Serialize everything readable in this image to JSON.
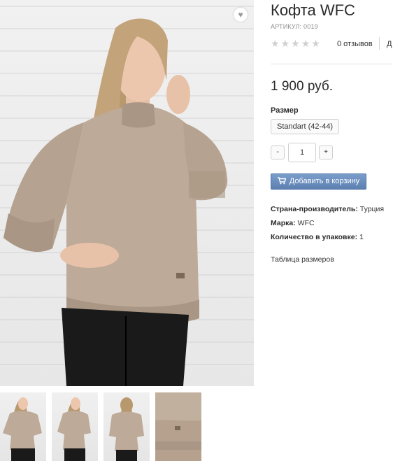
{
  "product": {
    "title": "Кофта WFC",
    "sku": "АРТИКУЛ: 0019",
    "rating_stars": 0,
    "reviews": "0 отзывов",
    "reviews_cut_link": "Д",
    "price": "1 900 руб."
  },
  "size": {
    "label": "Размер",
    "option": "Standart (42-44)"
  },
  "quantity": {
    "minus": "-",
    "value": "1",
    "plus": "+"
  },
  "cart_button": {
    "icon": "shopping-cart-icon",
    "label": "Добавить в корзину"
  },
  "properties": [
    {
      "name": "Страна-производитель:",
      "value": "Турция"
    },
    {
      "name": "Марка:",
      "value": "WFC"
    },
    {
      "name": "Количество в упаковке:",
      "value": "1"
    }
  ],
  "size_table_link": "Таблица размеров",
  "wishlist_icon": "heart-icon",
  "gallery": {
    "main_image": "product-photo-woman-beige-sweater",
    "thumbnails": [
      "photo-front",
      "photo-side",
      "photo-back",
      "photo-detail"
    ]
  },
  "colors": {
    "sweater": "#bdaa98",
    "button": "#6b8fc0",
    "stars": "#cfcfcf"
  }
}
